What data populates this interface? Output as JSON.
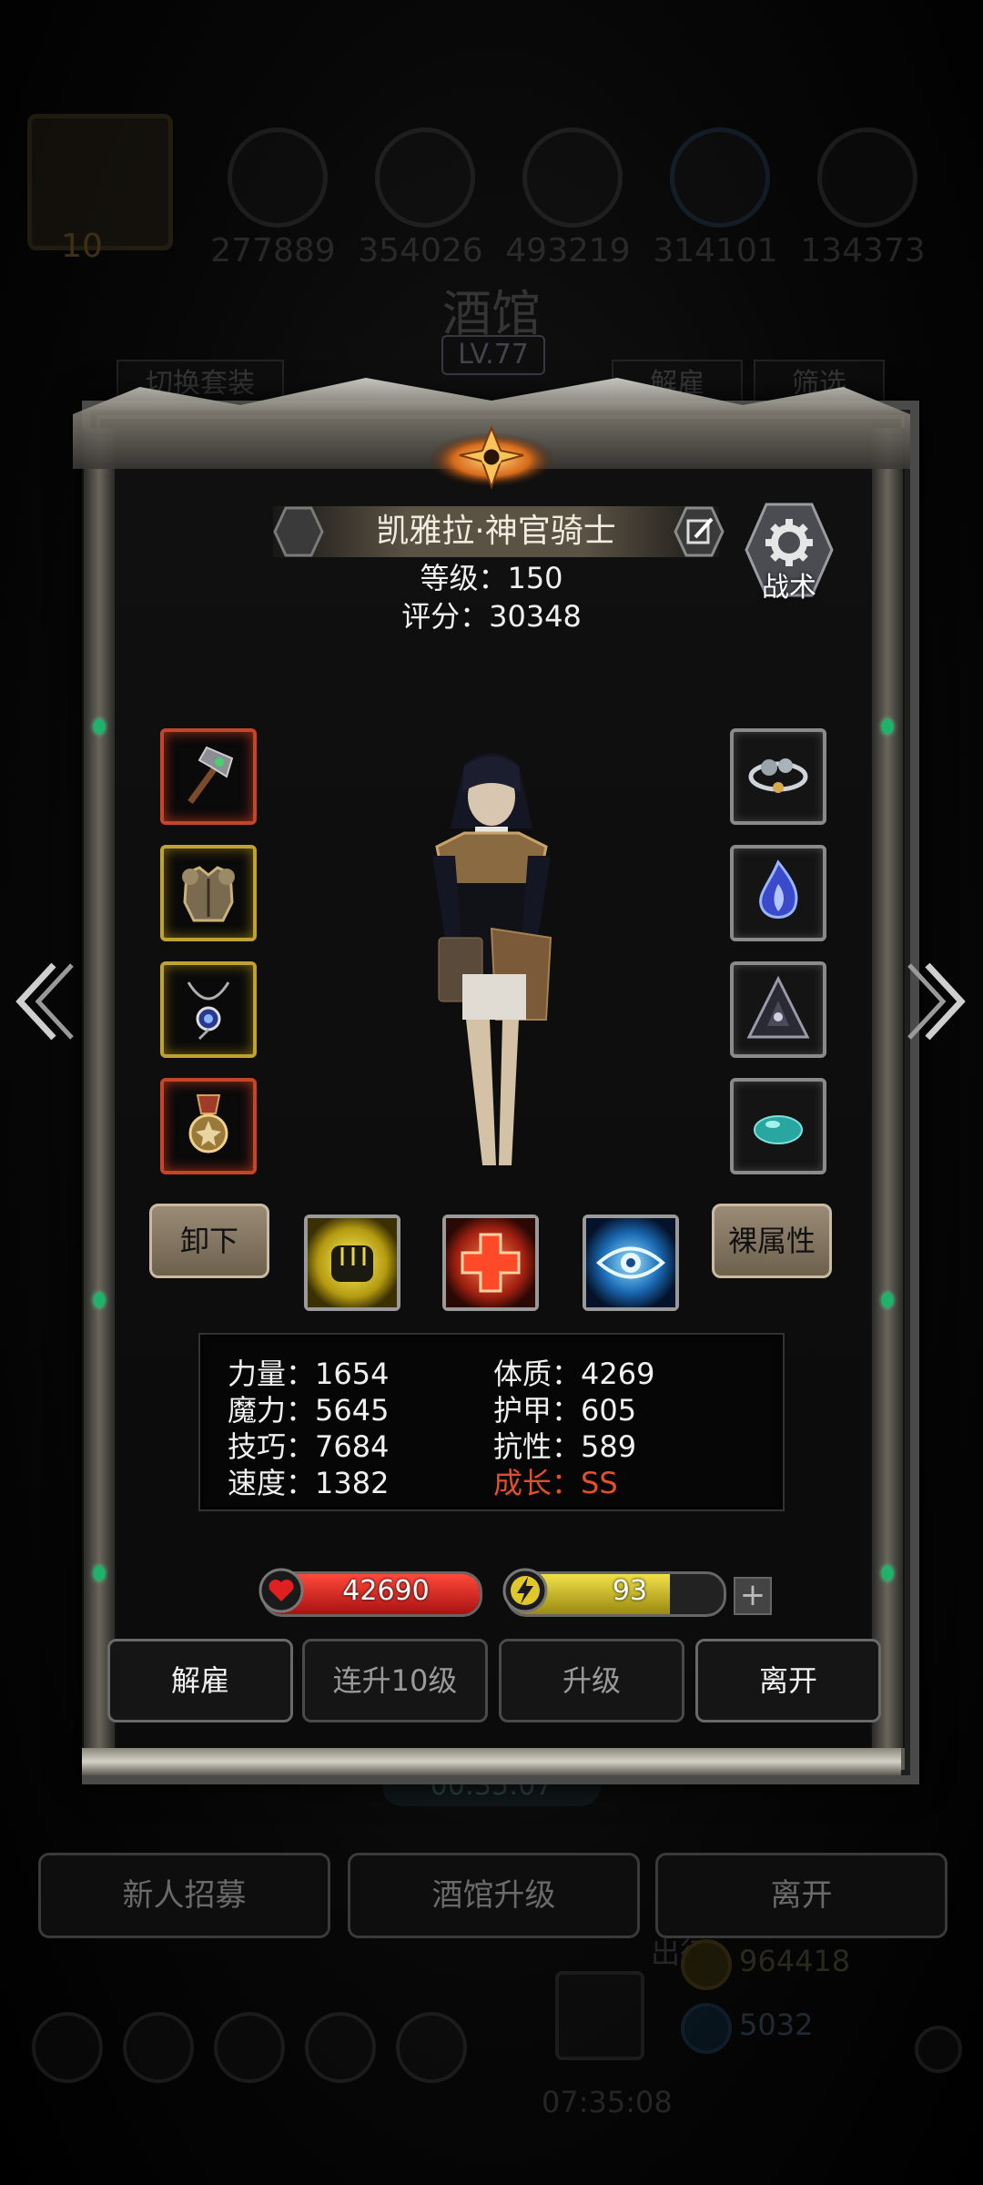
{
  "background": {
    "resources": [
      "277889",
      "354026",
      "493219",
      "314101",
      "134373"
    ],
    "player_level_badge": "10",
    "title": "酒馆",
    "level": "LV.77",
    "tab_switch_set": "切换套装",
    "tab_dismiss": "解雇",
    "tab_filter": "筛选",
    "timer": "00:35:07",
    "buttons": [
      "新人招募",
      "酒馆升级",
      "离开"
    ],
    "expedition_label": "出征",
    "expedition_timer": "07:35:08",
    "gold": "964418",
    "gems": "5032"
  },
  "hero": {
    "name": "凯雅拉·神官骑士",
    "level_line": "等级：150",
    "score_line": "评分：30348",
    "tactics_label": "战术"
  },
  "equipment": {
    "left": [
      "war-hammer",
      "chest-armor",
      "pendant-necklace",
      "medal"
    ],
    "right": [
      "cloud-ring",
      "blue-flame-gem",
      "dark-pyramid",
      "teal-stone"
    ]
  },
  "actions": {
    "unequip": "卸下",
    "base_attributes": "裸属性",
    "skills": [
      "fist-skill",
      "heal-cross-skill",
      "eye-skill"
    ]
  },
  "stats": {
    "left": [
      "力量：1654",
      "魔力：5645",
      "技巧：7684",
      "速度：1382"
    ],
    "right": [
      "体质：4269",
      "护甲：605",
      "抗性：589",
      "成长：SS"
    ]
  },
  "bars": {
    "hp": "42690",
    "energy": "93",
    "energy_fraction": 0.75
  },
  "bottom_buttons": [
    "解雇",
    "连升10级",
    "升级",
    "离开"
  ],
  "colors": {
    "growth": "#e0502a",
    "hp": "#c21e1e",
    "energy": "#c9b31c",
    "gem_green": "#1db36a"
  }
}
